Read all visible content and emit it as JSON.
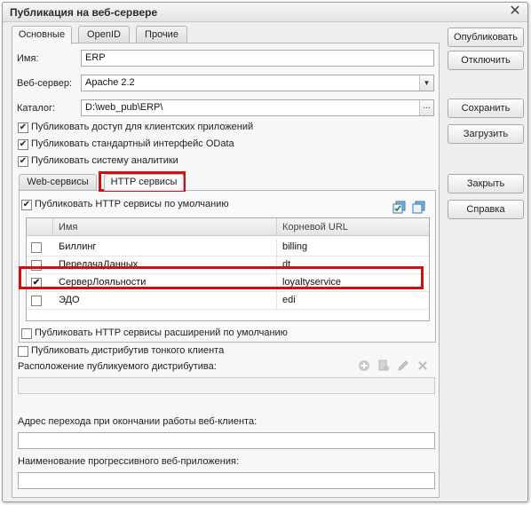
{
  "window": {
    "title": "Публикация на веб-сервере",
    "close": "✕"
  },
  "tabs": [
    "Основные",
    "OpenID",
    "Прочие"
  ],
  "form": {
    "name_label": "Имя:",
    "name_value": "ERP",
    "webserver_label": "Веб-сервер:",
    "webserver_value": "Apache 2.2",
    "catalog_label": "Каталог:",
    "catalog_value": "D:\\web_pub\\ERP\\",
    "catalog_btn": "...",
    "chk_clients": "Публиковать доступ для клиентских приложений",
    "chk_odata": "Публиковать стандартный интерфейс OData",
    "chk_analytics": "Публиковать систему аналитики",
    "chk_thin": "Публиковать дистрибутив тонкого клиента",
    "distrib_label": "Расположение публикуемого дистрибутива:",
    "distrib_value": "",
    "exit_label": "Адрес перехода при окончании работы веб-клиента:",
    "exit_value": "",
    "pwa_label": "Наименование прогрессивного веб-приложения:",
    "pwa_value": ""
  },
  "subtabs": [
    "Web-сервисы",
    "HTTP сервисы"
  ],
  "http": {
    "default_chk": "Публиковать HTTP сервисы по умолчанию",
    "ext_chk": "Публиковать HTTP сервисы расширений по умолчанию",
    "columns": [
      "Имя",
      "Корневой URL"
    ],
    "rows": [
      {
        "checked": false,
        "name": "Биллинг",
        "url": "billing"
      },
      {
        "checked": false,
        "name": "ПередачаДанных",
        "url": "dt"
      },
      {
        "checked": true,
        "name": "СерверЛояльности",
        "url": "loyaltyservice"
      },
      {
        "checked": false,
        "name": "ЭДО",
        "url": "edi"
      }
    ]
  },
  "buttons": {
    "publish": "Опубликовать",
    "disable": "Отключить",
    "save": "Сохранить",
    "load": "Загрузить",
    "close": "Закрыть",
    "help": "Справка"
  },
  "check_mark": "✔",
  "dropdown_arrow": "▼",
  "highlight_color": "#d01010"
}
